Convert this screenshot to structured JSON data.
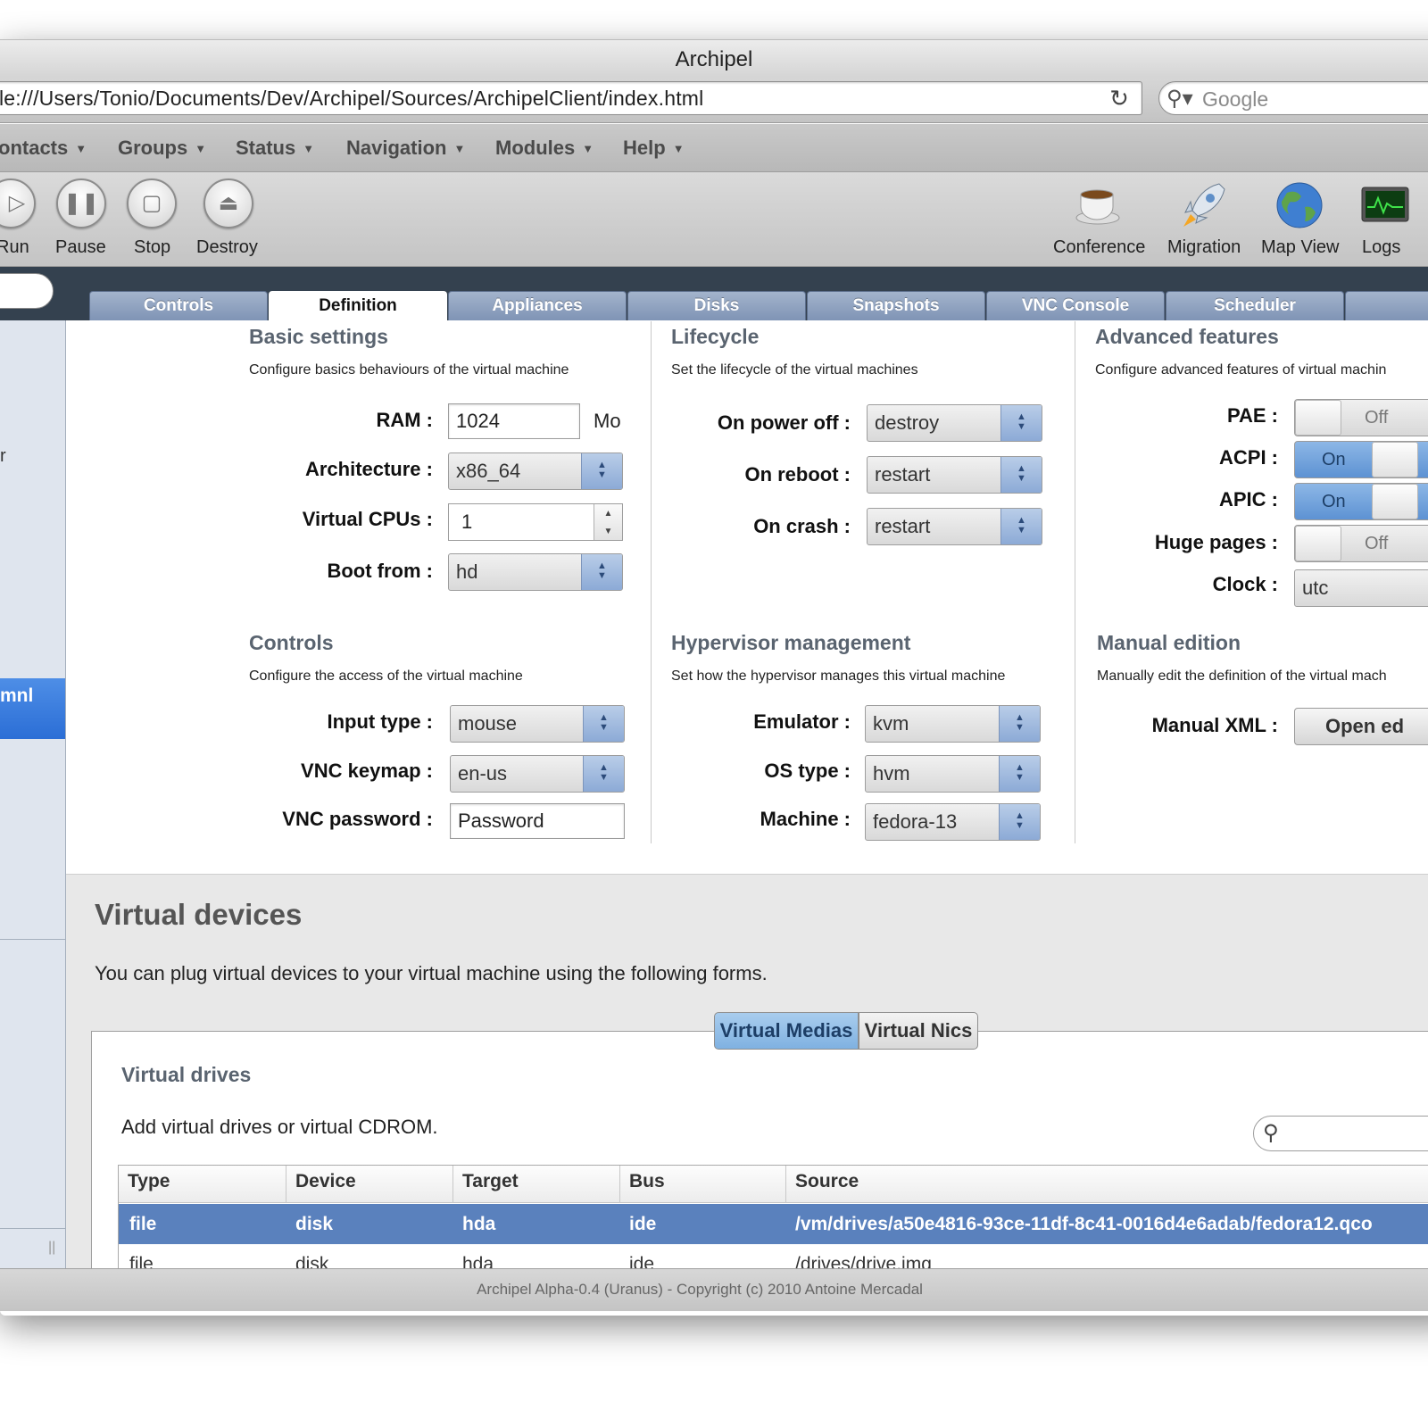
{
  "window": {
    "title": "Archipel"
  },
  "address": {
    "url": "le:///Users/Tonio/Documents/Dev/Archipel/Sources/ArchipelClient/index.html",
    "search_placeholder": "Google"
  },
  "menu": [
    "ontacts",
    "Groups",
    "Status",
    "Navigation",
    "Modules",
    "Help"
  ],
  "toolbar": {
    "left": [
      {
        "label": "Run",
        "icon": "play-icon"
      },
      {
        "label": "Pause",
        "icon": "pause-icon"
      },
      {
        "label": "Stop",
        "icon": "stop-icon"
      },
      {
        "label": "Destroy",
        "icon": "eject-icon"
      }
    ],
    "right": [
      {
        "label": "Conference",
        "icon": "coffee-cup-icon"
      },
      {
        "label": "Migration",
        "icon": "rocket-icon"
      },
      {
        "label": "Map View",
        "icon": "globe-icon"
      },
      {
        "label": "Logs",
        "icon": "monitor-icon"
      }
    ]
  },
  "tabs": [
    "Controls",
    "Definition",
    "Appliances",
    "Disks",
    "Snapshots",
    "VNC Console",
    "Scheduler"
  ],
  "active_tab": "Definition",
  "sidebar": {
    "fragment": "r",
    "selected": "mnl"
  },
  "basic": {
    "title": "Basic settings",
    "desc": "Configure basics behaviours of the virtual machine",
    "ram_label": "RAM :",
    "ram": "1024",
    "ram_unit": "Mo",
    "arch_label": "Architecture :",
    "arch": "x86_64",
    "cpus_label": "Virtual CPUs :",
    "cpus": "1",
    "boot_label": "Boot from :",
    "boot": "hd"
  },
  "lifecycle": {
    "title": "Lifecycle",
    "desc": "Set the lifecycle of the virtual machines",
    "poweroff_label": "On power off :",
    "poweroff": "destroy",
    "reboot_label": "On reboot :",
    "reboot": "restart",
    "crash_label": "On crash :",
    "crash": "restart"
  },
  "advanced": {
    "title": "Advanced features",
    "desc": "Configure advanced features of virtual machin",
    "pae_label": "PAE :",
    "pae": "Off",
    "acpi_label": "ACPI :",
    "acpi": "On",
    "apic_label": "APIC :",
    "apic": "On",
    "huge_label": "Huge pages :",
    "huge": "Off",
    "clock_label": "Clock :",
    "clock": "utc"
  },
  "controls": {
    "title": "Controls",
    "desc": "Configure the access of the virtual machine",
    "input_label": "Input type :",
    "input": "mouse",
    "keymap_label": "VNC keymap :",
    "keymap": "en-us",
    "password_label": "VNC password :",
    "password": "Password"
  },
  "hypervisor": {
    "title": "Hypervisor management",
    "desc": "Set how the hypervisor manages this virtual machine",
    "emulator_label": "Emulator :",
    "emulator": "kvm",
    "ostype_label": "OS type :",
    "ostype": "hvm",
    "machine_label": "Machine :",
    "machine": "fedora-13"
  },
  "manual": {
    "title": "Manual edition",
    "desc": "Manually edit the definition of the virtual mach",
    "xml_label": "Manual XML :",
    "button": "Open ed"
  },
  "devices": {
    "title": "Virtual devices",
    "desc": "You can plug virtual devices to your virtual machine using the following forms.",
    "subtabs": [
      "Virtual Medias",
      "Virtual Nics"
    ],
    "section_title": "Virtual drives",
    "section_desc": "Add virtual drives or virtual CDROM.",
    "columns": [
      "Type",
      "Device",
      "Target",
      "Bus",
      "Source"
    ],
    "rows": [
      [
        "file",
        "disk",
        "hda",
        "ide",
        "/vm/drives/a50e4816-93ce-11df-8c41-0016d4e6adab/fedora12.qco"
      ],
      [
        "file",
        "disk",
        "hda",
        "ide",
        "/drives/drive.img"
      ]
    ]
  },
  "footer": "Archipel Alpha-0.4 (Uranus) - Copyright (c) 2010 Antoine Mercadal",
  "colors": {
    "tab_bar": "#34414f",
    "selected_row": "#5a81bd",
    "sidebar_selected": "#2b6ed6"
  }
}
